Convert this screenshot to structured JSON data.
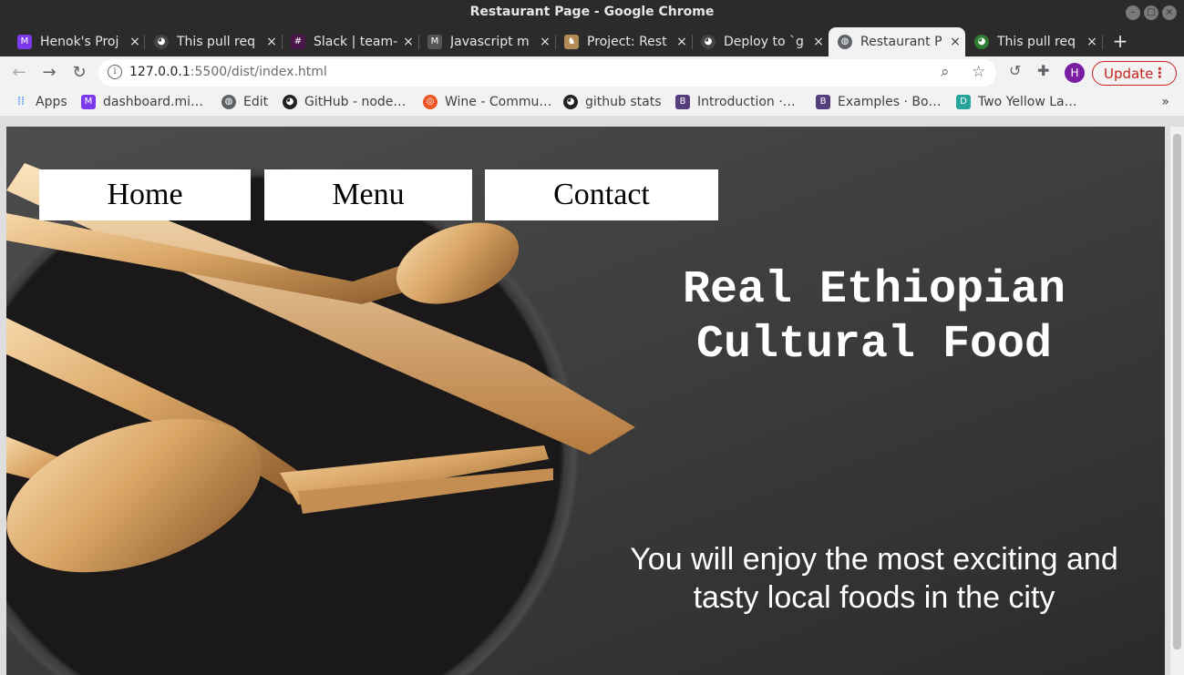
{
  "window": {
    "title": "Restaurant Page - Google Chrome"
  },
  "tabs": [
    {
      "label": "Henok's Proj",
      "icon": "microverse-icon",
      "color": "#7c3aed"
    },
    {
      "label": "This pull req",
      "icon": "github-icon",
      "color": "#444444"
    },
    {
      "label": "Slack | team-",
      "icon": "slack-icon",
      "color": "#4a154b"
    },
    {
      "label": "Javascript m",
      "icon": "microverse-icon",
      "color": "#555555"
    },
    {
      "label": "Project: Rest",
      "icon": "odin-project-icon",
      "color": "#b38b59"
    },
    {
      "label": "Deploy to `g",
      "icon": "github-icon",
      "color": "#444444"
    },
    {
      "label": "Restaurant P",
      "icon": "globe-icon",
      "color": "#5f6368",
      "active": true
    },
    {
      "label": "This pull req",
      "icon": "github-icon",
      "color": "#2e7d32"
    }
  ],
  "toolbar": {
    "url_host": "127.0.0.1",
    "url_rest": ":5500/dist/index.html",
    "avatar_letter": "H",
    "update_label": "Update"
  },
  "bookmarks": [
    {
      "label": "Apps",
      "icon": "apps-grid-icon"
    },
    {
      "label": "dashboard.mi…",
      "icon": "microverse-icon",
      "color": "#7c3aed"
    },
    {
      "label": "Edit",
      "icon": "globe-icon",
      "color": "#5f6368"
    },
    {
      "label": "GitHub - node…",
      "icon": "github-icon",
      "color": "#222222"
    },
    {
      "label": "Wine - Commu…",
      "icon": "ubuntu-icon",
      "color": "#e95420"
    },
    {
      "label": "github stats",
      "icon": "github-icon",
      "color": "#222222"
    },
    {
      "label": "Introduction ·…",
      "icon": "bootstrap-icon",
      "color": "#563d7c"
    },
    {
      "label": "Examples · Bo…",
      "icon": "bootstrap-icon",
      "color": "#563d7c"
    },
    {
      "label": "Two Yellow La…",
      "icon": "dribbble-icon",
      "color": "#26a69a"
    }
  ],
  "page": {
    "nav": [
      "Home",
      "Menu",
      "Contact"
    ],
    "hero_title": "Real Ethiopian Cultural Food",
    "hero_subtitle": "You will enjoy the most exciting and tasty local foods in the city"
  }
}
